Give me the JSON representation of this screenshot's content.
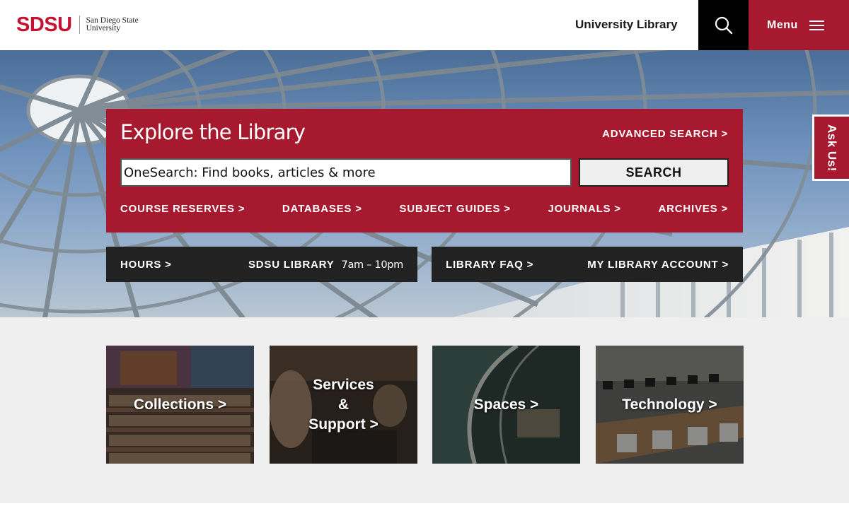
{
  "header": {
    "logo_mark": "SDSU",
    "logo_line1": "San Diego State",
    "logo_line2": "University",
    "site_title": "University Library",
    "search_icon": "search-icon",
    "menu_label": "Menu",
    "menu_icon": "hamburger-icon"
  },
  "explore": {
    "title": "Explore the Library",
    "advanced_search": "ADVANCED SEARCH >",
    "search_placeholder": "OneSearch: Find books, articles & more",
    "search_button": "SEARCH",
    "quick_links": [
      "COURSE RESERVES >",
      "DATABASES >",
      "SUBJECT GUIDES >",
      "JOURNALS >",
      "ARCHIVES >"
    ]
  },
  "info_bar": {
    "hours_link": "HOURS >",
    "hours_location": "SDSU LIBRARY",
    "hours_time": "7am – 10pm",
    "faq_link": "LIBRARY FAQ >",
    "account_link": "MY LIBRARY ACCOUNT >"
  },
  "ask_us": "Ask Us!",
  "tiles": [
    {
      "line1": "Collections >"
    },
    {
      "line1": "Services",
      "line2": "&",
      "line3": "Support >"
    },
    {
      "line1": "Spaces >"
    },
    {
      "line1": "Technology >"
    }
  ],
  "colors": {
    "brand_red": "#a6192e",
    "logo_red": "#c41230",
    "dark_bar": "#222222",
    "tiles_bg": "#efefef"
  }
}
